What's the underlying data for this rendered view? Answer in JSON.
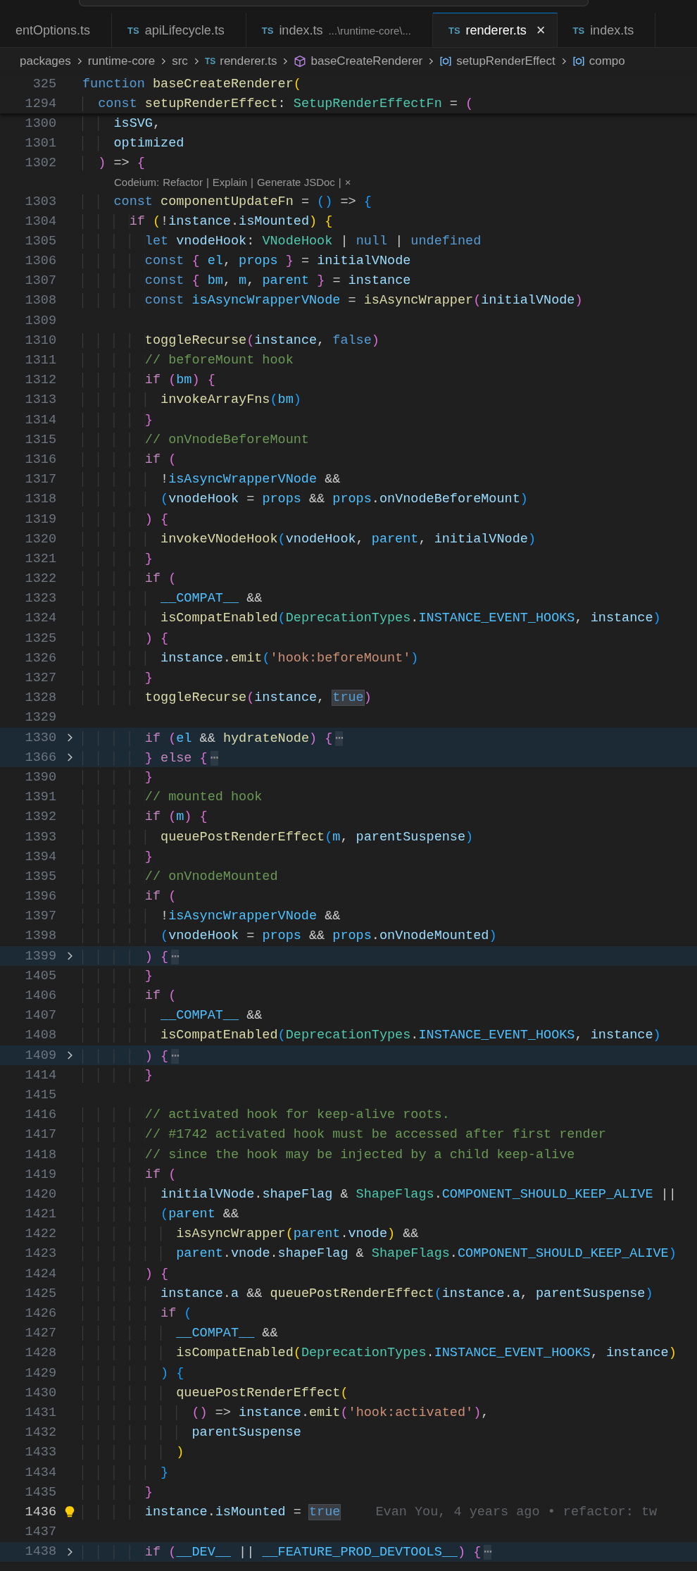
{
  "tabs": [
    {
      "label": "entOptions.ts",
      "selected": false
    },
    {
      "icon_text": "TS",
      "label": "apiLifecycle.ts",
      "selected": false
    },
    {
      "icon_text": "TS",
      "label": "index.ts",
      "description": "...\\runtime-core\\...",
      "selected": false
    },
    {
      "icon_text": "TS",
      "label": "renderer.ts",
      "selected": true,
      "close": "×"
    },
    {
      "icon_text": "TS",
      "label": "index.ts",
      "selected": false
    }
  ],
  "breadcrumb": [
    {
      "kind": "folder",
      "label": "packages"
    },
    {
      "kind": "folder",
      "label": "runtime-core"
    },
    {
      "kind": "folder",
      "label": "src"
    },
    {
      "kind": "file",
      "icon_text": "TS",
      "label": "renderer.ts"
    },
    {
      "kind": "module",
      "label": "baseCreateRenderer"
    },
    {
      "kind": "variable",
      "label": "setupRenderEffect"
    },
    {
      "kind": "variable",
      "label": "compo"
    }
  ],
  "sticky_lines": [
    {
      "number": "325",
      "tokens": [
        {
          "kind": "kw",
          "text": "function "
        },
        {
          "kind": "fn",
          "text": "baseCreateRenderer"
        },
        {
          "kind": "b1",
          "text": "("
        }
      ]
    },
    {
      "number": "1294",
      "tokens": [
        {
          "kind": "kw",
          "text": "  const "
        },
        {
          "kind": "fn",
          "text": "setupRenderEffect"
        },
        {
          "kind": "op",
          "text": ": "
        },
        {
          "kind": "type",
          "text": "SetupRenderEffectFn"
        },
        {
          "kind": "op",
          "text": " = "
        },
        {
          "kind": "b2",
          "text": "("
        }
      ]
    }
  ],
  "lines": [
    {
      "kind": "code",
      "number": "1300",
      "tokens": [
        {
          "kind": "var",
          "text": "    isSVG"
        },
        {
          "kind": "op",
          "text": ","
        }
      ]
    },
    {
      "kind": "code",
      "number": "1301",
      "tokens": [
        {
          "kind": "var",
          "text": "    optimized"
        }
      ]
    },
    {
      "kind": "code",
      "number": "1302",
      "tokens": [
        {
          "kind": "b2",
          "text": "  )"
        },
        {
          "kind": "op",
          "text": " => "
        },
        {
          "kind": "b2",
          "text": "{"
        }
      ]
    },
    {
      "kind": "lens",
      "label": "Codeium:",
      "actions": [
        "Refactor",
        "Explain",
        "Generate JSDoc"
      ],
      "separators": [
        "|",
        "|",
        "|"
      ],
      "close": "×"
    },
    {
      "kind": "code",
      "number": "1303",
      "tokens": [
        {
          "kind": "kw",
          "text": "    const "
        },
        {
          "kind": "fn",
          "text": "componentUpdateFn"
        },
        {
          "kind": "op",
          "text": " = "
        },
        {
          "kind": "b3",
          "text": "()"
        },
        {
          "kind": "op",
          "text": " => "
        },
        {
          "kind": "b3",
          "text": "{"
        }
      ]
    },
    {
      "kind": "code",
      "number": "1304",
      "tokens": [
        {
          "kind": "ctl",
          "text": "      if "
        },
        {
          "kind": "b1",
          "text": "("
        },
        {
          "kind": "op",
          "text": "!"
        },
        {
          "kind": "var",
          "text": "instance"
        },
        {
          "kind": "op",
          "text": "."
        },
        {
          "kind": "var",
          "text": "isMounted"
        },
        {
          "kind": "b1",
          "text": ") "
        },
        {
          "kind": "b1",
          "text": "{"
        }
      ]
    },
    {
      "kind": "code",
      "number": "1305",
      "tokens": [
        {
          "kind": "kw",
          "text": "        let "
        },
        {
          "kind": "var",
          "text": "vnodeHook"
        },
        {
          "kind": "op",
          "text": ": "
        },
        {
          "kind": "type",
          "text": "VNodeHook"
        },
        {
          "kind": "op",
          "text": " | "
        },
        {
          "kind": "kw",
          "text": "null"
        },
        {
          "kind": "op",
          "text": " | "
        },
        {
          "kind": "kw",
          "text": "undefined"
        }
      ]
    },
    {
      "kind": "code",
      "number": "1306",
      "tokens": [
        {
          "kind": "kw",
          "text": "        const "
        },
        {
          "kind": "b2",
          "text": "{ "
        },
        {
          "kind": "const",
          "text": "el"
        },
        {
          "kind": "op",
          "text": ", "
        },
        {
          "kind": "const",
          "text": "props"
        },
        {
          "kind": "b2",
          "text": " }"
        },
        {
          "kind": "op",
          "text": " = "
        },
        {
          "kind": "var",
          "text": "initialVNode"
        }
      ]
    },
    {
      "kind": "code",
      "number": "1307",
      "tokens": [
        {
          "kind": "kw",
          "text": "        const "
        },
        {
          "kind": "b2",
          "text": "{ "
        },
        {
          "kind": "const",
          "text": "bm"
        },
        {
          "kind": "op",
          "text": ", "
        },
        {
          "kind": "const",
          "text": "m"
        },
        {
          "kind": "op",
          "text": ", "
        },
        {
          "kind": "const",
          "text": "parent"
        },
        {
          "kind": "b2",
          "text": " }"
        },
        {
          "kind": "op",
          "text": " = "
        },
        {
          "kind": "var",
          "text": "instance"
        }
      ]
    },
    {
      "kind": "code",
      "number": "1308",
      "tokens": [
        {
          "kind": "kw",
          "text": "        const "
        },
        {
          "kind": "const",
          "text": "isAsyncWrapperVNode"
        },
        {
          "kind": "op",
          "text": " = "
        },
        {
          "kind": "fn",
          "text": "isAsyncWrapper"
        },
        {
          "kind": "b2",
          "text": "("
        },
        {
          "kind": "var",
          "text": "initialVNode"
        },
        {
          "kind": "b2",
          "text": ")"
        }
      ]
    },
    {
      "kind": "code",
      "number": "1309"
    },
    {
      "kind": "code",
      "number": "1310",
      "tokens": [
        {
          "kind": "fn",
          "text": "        toggleRecurse"
        },
        {
          "kind": "b2",
          "text": "("
        },
        {
          "kind": "var",
          "text": "instance"
        },
        {
          "kind": "op",
          "text": ", "
        },
        {
          "kind": "kw",
          "text": "false"
        },
        {
          "kind": "b2",
          "text": ")"
        }
      ]
    },
    {
      "kind": "code",
      "number": "1311",
      "tokens": [
        {
          "kind": "cmt",
          "text": "        // beforeMount hook"
        }
      ]
    },
    {
      "kind": "code",
      "number": "1312",
      "tokens": [
        {
          "kind": "ctl",
          "text": "        if "
        },
        {
          "kind": "b2",
          "text": "("
        },
        {
          "kind": "const",
          "text": "bm"
        },
        {
          "kind": "b2",
          "text": ") {"
        }
      ]
    },
    {
      "kind": "code",
      "number": "1313",
      "tokens": [
        {
          "kind": "fn",
          "text": "          invokeArrayFns"
        },
        {
          "kind": "b3",
          "text": "("
        },
        {
          "kind": "const",
          "text": "bm"
        },
        {
          "kind": "b3",
          "text": ")"
        }
      ]
    },
    {
      "kind": "code",
      "number": "1314",
      "tokens": [
        {
          "kind": "b2",
          "text": "        }"
        }
      ]
    },
    {
      "kind": "code",
      "number": "1315",
      "tokens": [
        {
          "kind": "cmt",
          "text": "        // onVnodeBeforeMount"
        }
      ]
    },
    {
      "kind": "code",
      "number": "1316",
      "tokens": [
        {
          "kind": "ctl",
          "text": "        if "
        },
        {
          "kind": "b2",
          "text": "("
        }
      ]
    },
    {
      "kind": "code",
      "number": "1317",
      "tokens": [
        {
          "kind": "op",
          "text": "          !"
        },
        {
          "kind": "const",
          "text": "isAsyncWrapperVNode"
        },
        {
          "kind": "op",
          "text": " &&"
        }
      ]
    },
    {
      "kind": "code",
      "number": "1318",
      "tokens": [
        {
          "kind": "b3",
          "text": "          ("
        },
        {
          "kind": "var",
          "text": "vnodeHook"
        },
        {
          "kind": "op",
          "text": " = "
        },
        {
          "kind": "const",
          "text": "props"
        },
        {
          "kind": "op",
          "text": " && "
        },
        {
          "kind": "const",
          "text": "props"
        },
        {
          "kind": "op",
          "text": "."
        },
        {
          "kind": "var",
          "text": "onVnodeBeforeMount"
        },
        {
          "kind": "b3",
          "text": ")"
        }
      ]
    },
    {
      "kind": "code",
      "number": "1319",
      "tokens": [
        {
          "kind": "b2",
          "text": "        ) {"
        }
      ]
    },
    {
      "kind": "code",
      "number": "1320",
      "tokens": [
        {
          "kind": "fn",
          "text": "          invokeVNodeHook"
        },
        {
          "kind": "b3",
          "text": "("
        },
        {
          "kind": "var",
          "text": "vnodeHook"
        },
        {
          "kind": "op",
          "text": ", "
        },
        {
          "kind": "const",
          "text": "parent"
        },
        {
          "kind": "op",
          "text": ", "
        },
        {
          "kind": "var",
          "text": "initialVNode"
        },
        {
          "kind": "b3",
          "text": ")"
        }
      ]
    },
    {
      "kind": "code",
      "number": "1321",
      "tokens": [
        {
          "kind": "b2",
          "text": "        }"
        }
      ]
    },
    {
      "kind": "code",
      "number": "1322",
      "tokens": [
        {
          "kind": "ctl",
          "text": "        if "
        },
        {
          "kind": "b2",
          "text": "("
        }
      ]
    },
    {
      "kind": "code",
      "number": "1323",
      "tokens": [
        {
          "kind": "const",
          "text": "          __COMPAT__"
        },
        {
          "kind": "op",
          "text": " &&"
        }
      ]
    },
    {
      "kind": "code",
      "number": "1324",
      "tokens": [
        {
          "kind": "fn",
          "text": "          isCompatEnabled"
        },
        {
          "kind": "b3",
          "text": "("
        },
        {
          "kind": "type",
          "text": "DeprecationTypes"
        },
        {
          "kind": "op",
          "text": "."
        },
        {
          "kind": "const",
          "text": "INSTANCE_EVENT_HOOKS"
        },
        {
          "kind": "op",
          "text": ", "
        },
        {
          "kind": "var",
          "text": "instance"
        },
        {
          "kind": "b3",
          "text": ")"
        }
      ]
    },
    {
      "kind": "code",
      "number": "1325",
      "tokens": [
        {
          "kind": "b2",
          "text": "        ) {"
        }
      ]
    },
    {
      "kind": "code",
      "number": "1326",
      "tokens": [
        {
          "kind": "var",
          "text": "          instance"
        },
        {
          "kind": "op",
          "text": "."
        },
        {
          "kind": "fn",
          "text": "emit"
        },
        {
          "kind": "b3",
          "text": "("
        },
        {
          "kind": "str",
          "text": "'hook:beforeMount'"
        },
        {
          "kind": "b3",
          "text": ")"
        }
      ]
    },
    {
      "kind": "code",
      "number": "1327",
      "tokens": [
        {
          "kind": "b2",
          "text": "        }"
        }
      ]
    },
    {
      "kind": "code",
      "number": "1328",
      "tokens": [
        {
          "kind": "fn",
          "text": "        toggleRecurse"
        },
        {
          "kind": "b2",
          "text": "("
        },
        {
          "kind": "var",
          "text": "instance"
        },
        {
          "kind": "op",
          "text": ", "
        },
        {
          "kind": "match",
          "text": "true"
        },
        {
          "kind": "b2",
          "text": ")"
        }
      ]
    },
    {
      "kind": "code",
      "number": "1329"
    },
    {
      "kind": "folded",
      "number": "1330",
      "tokens": [
        {
          "kind": "ctl",
          "text": "        if "
        },
        {
          "kind": "b2",
          "text": "("
        },
        {
          "kind": "const",
          "text": "el"
        },
        {
          "kind": "op",
          "text": " && "
        },
        {
          "kind": "fn",
          "text": "hydrateNode"
        },
        {
          "kind": "b2",
          "text": ") {"
        },
        {
          "kind": "dots",
          "text": "⋯"
        }
      ]
    },
    {
      "kind": "folded",
      "number": "1366",
      "tokens": [
        {
          "kind": "b2",
          "text": "        } "
        },
        {
          "kind": "ctl",
          "text": "else "
        },
        {
          "kind": "b2",
          "text": "{"
        },
        {
          "kind": "dots",
          "text": "⋯"
        }
      ]
    },
    {
      "kind": "code",
      "number": "1390",
      "tokens": [
        {
          "kind": "b2",
          "text": "        }"
        }
      ]
    },
    {
      "kind": "code",
      "number": "1391",
      "tokens": [
        {
          "kind": "cmt",
          "text": "        // mounted hook"
        }
      ]
    },
    {
      "kind": "code",
      "number": "1392",
      "tokens": [
        {
          "kind": "ctl",
          "text": "        if "
        },
        {
          "kind": "b2",
          "text": "("
        },
        {
          "kind": "const",
          "text": "m"
        },
        {
          "kind": "b2",
          "text": ") {"
        }
      ]
    },
    {
      "kind": "code",
      "number": "1393",
      "tokens": [
        {
          "kind": "fn",
          "text": "          queuePostRenderEffect"
        },
        {
          "kind": "b3",
          "text": "("
        },
        {
          "kind": "const",
          "text": "m"
        },
        {
          "kind": "op",
          "text": ", "
        },
        {
          "kind": "var",
          "text": "parentSuspense"
        },
        {
          "kind": "b3",
          "text": ")"
        }
      ]
    },
    {
      "kind": "code",
      "number": "1394",
      "tokens": [
        {
          "kind": "b2",
          "text": "        }"
        }
      ]
    },
    {
      "kind": "code",
      "number": "1395",
      "tokens": [
        {
          "kind": "cmt",
          "text": "        // onVnodeMounted"
        }
      ]
    },
    {
      "kind": "code",
      "number": "1396",
      "tokens": [
        {
          "kind": "ctl",
          "text": "        if "
        },
        {
          "kind": "b2",
          "text": "("
        }
      ]
    },
    {
      "kind": "code",
      "number": "1397",
      "tokens": [
        {
          "kind": "op",
          "text": "          !"
        },
        {
          "kind": "const",
          "text": "isAsyncWrapperVNode"
        },
        {
          "kind": "op",
          "text": " &&"
        }
      ]
    },
    {
      "kind": "code",
      "number": "1398",
      "tokens": [
        {
          "kind": "b3",
          "text": "          ("
        },
        {
          "kind": "var",
          "text": "vnodeHook"
        },
        {
          "kind": "op",
          "text": " = "
        },
        {
          "kind": "const",
          "text": "props"
        },
        {
          "kind": "op",
          "text": " && "
        },
        {
          "kind": "const",
          "text": "props"
        },
        {
          "kind": "op",
          "text": "."
        },
        {
          "kind": "var",
          "text": "onVnodeMounted"
        },
        {
          "kind": "b3",
          "text": ")"
        }
      ]
    },
    {
      "kind": "folded",
      "number": "1399",
      "tokens": [
        {
          "kind": "b2",
          "text": "        ) {"
        },
        {
          "kind": "dots",
          "text": "⋯"
        }
      ]
    },
    {
      "kind": "code",
      "number": "1405",
      "tokens": [
        {
          "kind": "b2",
          "text": "        }"
        }
      ]
    },
    {
      "kind": "code",
      "number": "1406",
      "tokens": [
        {
          "kind": "ctl",
          "text": "        if "
        },
        {
          "kind": "b2",
          "text": "("
        }
      ]
    },
    {
      "kind": "code",
      "number": "1407",
      "tokens": [
        {
          "kind": "const",
          "text": "          __COMPAT__"
        },
        {
          "kind": "op",
          "text": " &&"
        }
      ]
    },
    {
      "kind": "code",
      "number": "1408",
      "tokens": [
        {
          "kind": "fn",
          "text": "          isCompatEnabled"
        },
        {
          "kind": "b3",
          "text": "("
        },
        {
          "kind": "type",
          "text": "DeprecationTypes"
        },
        {
          "kind": "op",
          "text": "."
        },
        {
          "kind": "const",
          "text": "INSTANCE_EVENT_HOOKS"
        },
        {
          "kind": "op",
          "text": ", "
        },
        {
          "kind": "var",
          "text": "instance"
        },
        {
          "kind": "b3",
          "text": ")"
        }
      ]
    },
    {
      "kind": "folded",
      "number": "1409",
      "tokens": [
        {
          "kind": "b2",
          "text": "        ) {"
        },
        {
          "kind": "dots",
          "text": "⋯"
        }
      ]
    },
    {
      "kind": "code",
      "number": "1414",
      "tokens": [
        {
          "kind": "b2",
          "text": "        }"
        }
      ]
    },
    {
      "kind": "code",
      "number": "1415"
    },
    {
      "kind": "code",
      "number": "1416",
      "tokens": [
        {
          "kind": "cmt",
          "text": "        // activated hook for keep-alive roots."
        }
      ]
    },
    {
      "kind": "code",
      "number": "1417",
      "tokens": [
        {
          "kind": "cmt",
          "text": "        // #1742 activated hook must be accessed after first render"
        }
      ]
    },
    {
      "kind": "code",
      "number": "1418",
      "tokens": [
        {
          "kind": "cmt",
          "text": "        // since the hook may be injected by a child keep-alive"
        }
      ]
    },
    {
      "kind": "code",
      "number": "1419",
      "tokens": [
        {
          "kind": "ctl",
          "text": "        if "
        },
        {
          "kind": "b2",
          "text": "("
        }
      ]
    },
    {
      "kind": "code",
      "number": "1420",
      "tokens": [
        {
          "kind": "var",
          "text": "          initialVNode"
        },
        {
          "kind": "op",
          "text": "."
        },
        {
          "kind": "var",
          "text": "shapeFlag"
        },
        {
          "kind": "op",
          "text": " & "
        },
        {
          "kind": "type",
          "text": "ShapeFlags"
        },
        {
          "kind": "op",
          "text": "."
        },
        {
          "kind": "const",
          "text": "COMPONENT_SHOULD_KEEP_ALIVE"
        },
        {
          "kind": "op",
          "text": " ||"
        }
      ]
    },
    {
      "kind": "code",
      "number": "1421",
      "tokens": [
        {
          "kind": "b3",
          "text": "          ("
        },
        {
          "kind": "const",
          "text": "parent"
        },
        {
          "kind": "op",
          "text": " &&"
        }
      ]
    },
    {
      "kind": "code",
      "number": "1422",
      "tokens": [
        {
          "kind": "fn",
          "text": "            isAsyncWrapper"
        },
        {
          "kind": "b1",
          "text": "("
        },
        {
          "kind": "const",
          "text": "parent"
        },
        {
          "kind": "op",
          "text": "."
        },
        {
          "kind": "var",
          "text": "vnode"
        },
        {
          "kind": "b1",
          "text": ")"
        },
        {
          "kind": "op",
          "text": " &&"
        }
      ]
    },
    {
      "kind": "code",
      "number": "1423",
      "tokens": [
        {
          "kind": "const",
          "text": "            parent"
        },
        {
          "kind": "op",
          "text": "."
        },
        {
          "kind": "var",
          "text": "vnode"
        },
        {
          "kind": "op",
          "text": "."
        },
        {
          "kind": "var",
          "text": "shapeFlag"
        },
        {
          "kind": "op",
          "text": " & "
        },
        {
          "kind": "type",
          "text": "ShapeFlags"
        },
        {
          "kind": "op",
          "text": "."
        },
        {
          "kind": "const",
          "text": "COMPONENT_SHOULD_KEEP_ALIVE"
        },
        {
          "kind": "b3",
          "text": ")"
        }
      ]
    },
    {
      "kind": "code",
      "number": "1424",
      "tokens": [
        {
          "kind": "b2",
          "text": "        ) {"
        }
      ]
    },
    {
      "kind": "code",
      "number": "1425",
      "tokens": [
        {
          "kind": "var",
          "text": "          instance"
        },
        {
          "kind": "op",
          "text": "."
        },
        {
          "kind": "var",
          "text": "a"
        },
        {
          "kind": "op",
          "text": " && "
        },
        {
          "kind": "fn",
          "text": "queuePostRenderEffect"
        },
        {
          "kind": "b3",
          "text": "("
        },
        {
          "kind": "var",
          "text": "instance"
        },
        {
          "kind": "op",
          "text": "."
        },
        {
          "kind": "var",
          "text": "a"
        },
        {
          "kind": "op",
          "text": ", "
        },
        {
          "kind": "var",
          "text": "parentSuspense"
        },
        {
          "kind": "b3",
          "text": ")"
        }
      ]
    },
    {
      "kind": "code",
      "number": "1426",
      "tokens": [
        {
          "kind": "ctl",
          "text": "          if "
        },
        {
          "kind": "b3",
          "text": "("
        }
      ]
    },
    {
      "kind": "code",
      "number": "1427",
      "tokens": [
        {
          "kind": "const",
          "text": "            __COMPAT__"
        },
        {
          "kind": "op",
          "text": " &&"
        }
      ]
    },
    {
      "kind": "code",
      "number": "1428",
      "tokens": [
        {
          "kind": "fn",
          "text": "            isCompatEnabled"
        },
        {
          "kind": "b1",
          "text": "("
        },
        {
          "kind": "type",
          "text": "DeprecationTypes"
        },
        {
          "kind": "op",
          "text": "."
        },
        {
          "kind": "const",
          "text": "INSTANCE_EVENT_HOOKS"
        },
        {
          "kind": "op",
          "text": ", "
        },
        {
          "kind": "var",
          "text": "instance"
        },
        {
          "kind": "b1",
          "text": ")"
        }
      ]
    },
    {
      "kind": "code",
      "number": "1429",
      "tokens": [
        {
          "kind": "b3",
          "text": "          ) {"
        }
      ]
    },
    {
      "kind": "code",
      "number": "1430",
      "tokens": [
        {
          "kind": "fn",
          "text": "            queuePostRenderEffect"
        },
        {
          "kind": "b1",
          "text": "("
        }
      ]
    },
    {
      "kind": "code",
      "number": "1431",
      "tokens": [
        {
          "kind": "b2",
          "text": "              ()"
        },
        {
          "kind": "op",
          "text": " => "
        },
        {
          "kind": "var",
          "text": "instance"
        },
        {
          "kind": "op",
          "text": "."
        },
        {
          "kind": "fn",
          "text": "emit"
        },
        {
          "kind": "b2",
          "text": "("
        },
        {
          "kind": "str",
          "text": "'hook:activated'"
        },
        {
          "kind": "b2",
          "text": ")"
        },
        {
          "kind": "op",
          "text": ","
        }
      ]
    },
    {
      "kind": "code",
      "number": "1432",
      "tokens": [
        {
          "kind": "var",
          "text": "              parentSuspense"
        }
      ]
    },
    {
      "kind": "code",
      "number": "1433",
      "tokens": [
        {
          "kind": "b1",
          "text": "            )"
        }
      ]
    },
    {
      "kind": "code",
      "number": "1434",
      "tokens": [
        {
          "kind": "b3",
          "text": "          }"
        }
      ]
    },
    {
      "kind": "code",
      "number": "1435",
      "tokens": [
        {
          "kind": "b2",
          "text": "        }"
        }
      ]
    },
    {
      "kind": "current",
      "number": "1436",
      "tokens": [
        {
          "kind": "var",
          "text": "        instance"
        },
        {
          "kind": "op",
          "text": "."
        },
        {
          "kind": "var",
          "text": "isMounted"
        },
        {
          "kind": "op",
          "text": " = "
        },
        {
          "kind": "match",
          "text": "true"
        }
      ],
      "blame": "Evan You, 4 years ago • refactor: tw"
    },
    {
      "kind": "code",
      "number": "1437"
    },
    {
      "kind": "folded",
      "number": "1438",
      "tokens": [
        {
          "kind": "ctl",
          "text": "        if "
        },
        {
          "kind": "b2",
          "text": "("
        },
        {
          "kind": "const",
          "text": "__DEV__"
        },
        {
          "kind": "op",
          "text": " || "
        },
        {
          "kind": "const",
          "text": "__FEATURE_PROD_DEVTOOLS__"
        },
        {
          "kind": "b2",
          "text": ") {"
        },
        {
          "kind": "dots",
          "text": "⋯"
        }
      ]
    }
  ]
}
